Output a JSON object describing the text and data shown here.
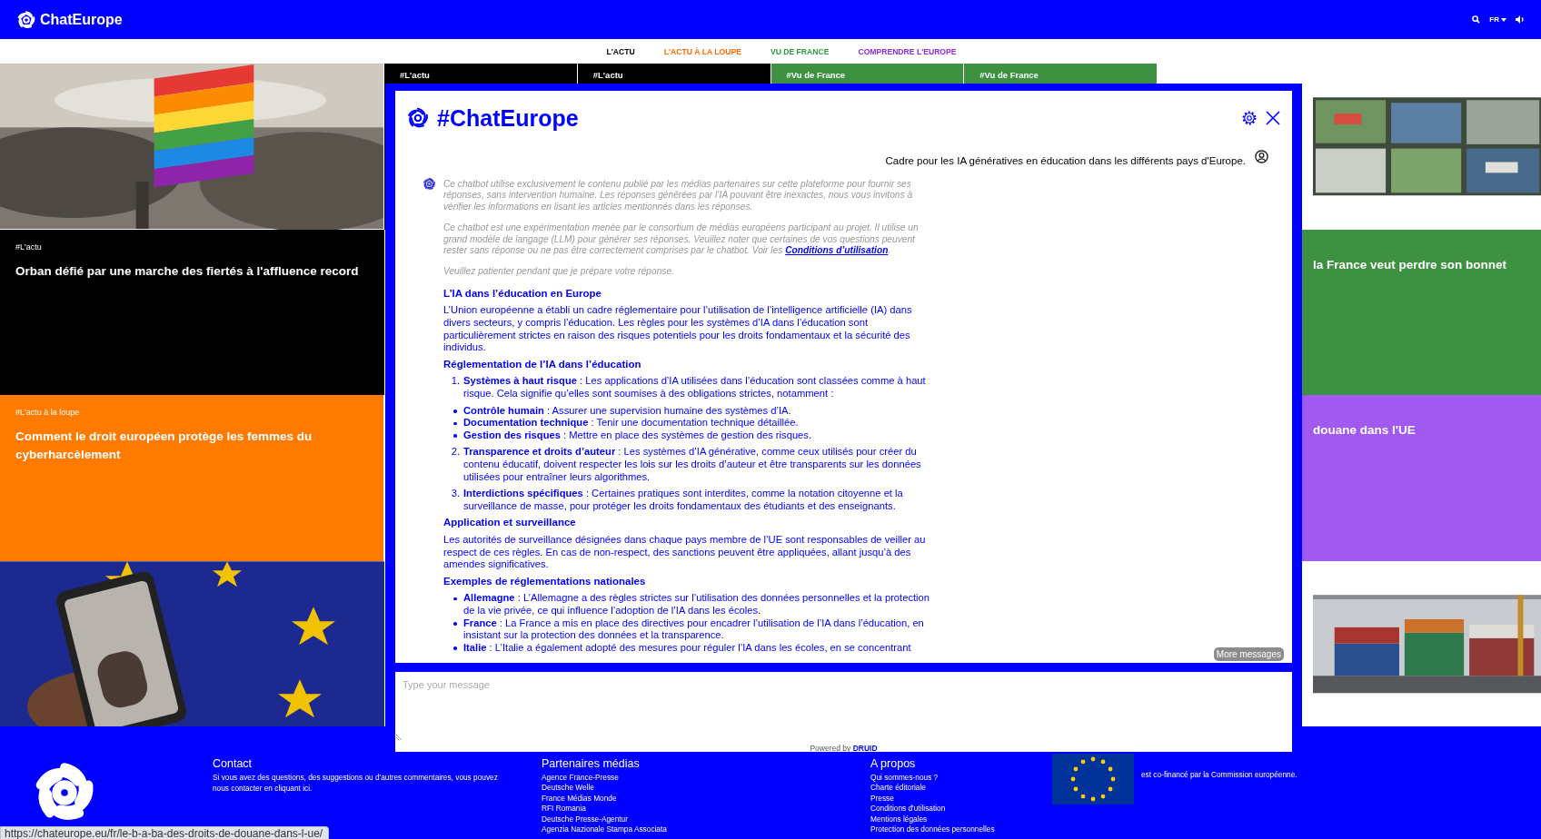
{
  "header": {
    "logo": "ChatEurope",
    "language": "FR"
  },
  "nav": [
    {
      "label": "L'ACTU",
      "color": "#000000"
    },
    {
      "label": "L'ACTU À LA LOUPE",
      "color": "#ff6a00"
    },
    {
      "label": "VU DE FRANCE",
      "color": "#2e9a3a"
    },
    {
      "label": "COMPRENDRE L'EUROPE",
      "color": "#8a2be2"
    }
  ],
  "tiles_left": [
    {
      "kind": "picture"
    },
    {
      "kind": "story",
      "color": "#000000",
      "tag": "#L'actu",
      "title": "Orban défié par une marche des fiertés à l'affluence record"
    },
    {
      "kind": "story",
      "color": "#ff7a00",
      "tag": "#L'actu à la loupe",
      "title": "Comment le droit européen protège les femmes du cyberharcèlement"
    },
    {
      "kind": "picture"
    }
  ],
  "tiles_middle": [
    {
      "tag": "#L'actu",
      "color": "#000000"
    },
    {
      "tag": "#L'actu",
      "color": "#000000"
    },
    {
      "tag": "#Vu de France",
      "color": "#3f9142"
    },
    {
      "tag": "#Vu de France",
      "color": "#3f9142"
    }
  ],
  "tiles_right": [
    {
      "kind": "picture"
    },
    {
      "kind": "story",
      "color": "#3f9142",
      "title": "la France veut perdre son bonnet"
    },
    {
      "kind": "story",
      "color": "#a259f0",
      "title": "douane dans l'UE"
    },
    {
      "kind": "picture"
    }
  ],
  "chat": {
    "title": "#ChatEurope",
    "messages": [
      {
        "kind": "user",
        "text": "Cadre pour les IA génératives en éducation dans les différents pays d'Europe."
      },
      {
        "kind": "bot",
        "blocks": [
          {
            "kind": "note",
            "text": "Ce chatbot utilise exclusivement le contenu publié par les médias partenaires sur cette plateforme pour fournir ses réponses, sans intervention humaine. Les réponses générées par l’IA pouvant être inexactes, nous vous invitons à vérifier les informations en lisant les articles mentionnés dans les réponses."
          },
          {
            "kind": "note",
            "text": "Ce chatbot est une expérimentation menée par le consortium de médias européens participant au projet. Il utilise un grand modèle de langage (LLM) pour générer ses réponses. Veuillez noter que certaines de vos questions peuvent rester sans réponse ou ne pas être correctement comprises par le chatbot. Voir les ",
            "link": "Conditions d’utilisation",
            "after": "."
          },
          {
            "kind": "note",
            "text": "Veuillez patienter pendant que je prépare votre réponse."
          },
          {
            "kind": "heading",
            "text": "L’IA dans l’éducation en Europe"
          },
          {
            "kind": "paragraph",
            "text": "L’Union européenne a établi un cadre réglementaire pour l’utilisation de l’intelligence artificielle (IA) dans divers secteurs, y compris l’éducation. Les règles pour les systèmes d’IA dans l’éducation sont particulièrement strictes en raison des risques potentiels pour les droits fondamentaux et la sécurité des individus."
          },
          {
            "kind": "heading",
            "text": "Réglementation de l’IA dans l’éducation"
          },
          {
            "kind": "ordered",
            "items": [
              {
                "number": "1.",
                "text": "**Systèmes à haut risque** : Les applications d’IA utilisées dans l’éducation sont classées comme à haut risque. Cela signifie qu’elles sont soumises à des obligations strictes, notamment :"
              }
            ]
          },
          {
            "kind": "bullets",
            "items": [
              "**Contrôle humain** : Assurer une supervision humaine des systèmes d’IA.",
              "**Documentation technique** : Tenir une documentation technique détaillée.",
              "**Gestion des risques** : Mettre en place des systèmes de gestion des risques."
            ]
          },
          {
            "kind": "ordered",
            "items": [
              {
                "number": "2.",
                "text": "**Transparence et droits d’auteur** : Les systèmes d’IA générative, comme ceux utilisés pour créer du contenu éducatif, doivent respecter les lois sur les droits d’auteur et être transparents sur les données utilisées pour entraîner leurs algorithmes."
              },
              {
                "number": "3.",
                "text": "**Interdictions spécifiques** : Certaines pratiques sont interdites, comme la notation citoyenne et la surveillance de masse, pour protéger les droits fondamentaux des étudiants et des enseignants."
              }
            ]
          },
          {
            "kind": "heading",
            "text": "Application et surveillance"
          },
          {
            "kind": "paragraph",
            "text": "Les autorités de surveillance désignées dans chaque pays membre de l’UE sont responsables de veiller au respect de ces règles. En cas de non-respect, des sanctions peuvent être appliquées, allant jusqu’à des amendes significatives."
          },
          {
            "kind": "heading",
            "text": "Exemples de réglementations nationales"
          },
          {
            "kind": "bullets",
            "items": [
              "**Allemagne** : L’Allemagne a des règles strictes sur l’utilisation des données personnelles et la protection de la vie privée, ce qui influence l’adoption de l’IA dans les écoles.",
              "**France** : La France a mis en place des directives pour encadrer l’utilisation de l’IA dans l’éducation, en insistant sur la protection des données et la transparence.",
              "**Italie** : L’Italie a également adopté des mesures pour réguler l’IA dans les écoles, en se concentrant"
            ]
          }
        ]
      }
    ],
    "more_button": "More messages",
    "input_placeholder": "Type your message",
    "powered_by": "Powered by ",
    "powered_link": "DRUID"
  },
  "footer": {
    "contact_title": "Contact",
    "contact_text": "Si vous avez des questions, des suggestions ou d'autres commentaires, vous pouvez nous contacter en cliquant ici.",
    "partners_title": "Partenaires médias",
    "partners": [
      "Agence France-Presse",
      "Deutsche Welle",
      "France Médias Monde",
      "RFI Romania",
      "Deutsche Presse-Agentur",
      "Agenzia Nazionale Stampa Associata"
    ],
    "about_title": "A propos",
    "about": [
      "Qui sommes-nous ?",
      "Charte éditoriale",
      "Presse",
      "Conditions d'utilisation",
      "Mentions légales",
      "Protection des données personnelles"
    ],
    "funding_text": "est co-financé par la Commission européenne."
  },
  "status_url": "https://chateurope.eu/fr/le-b-a-ba-des-droits-de-douane-dans-l-ue/"
}
